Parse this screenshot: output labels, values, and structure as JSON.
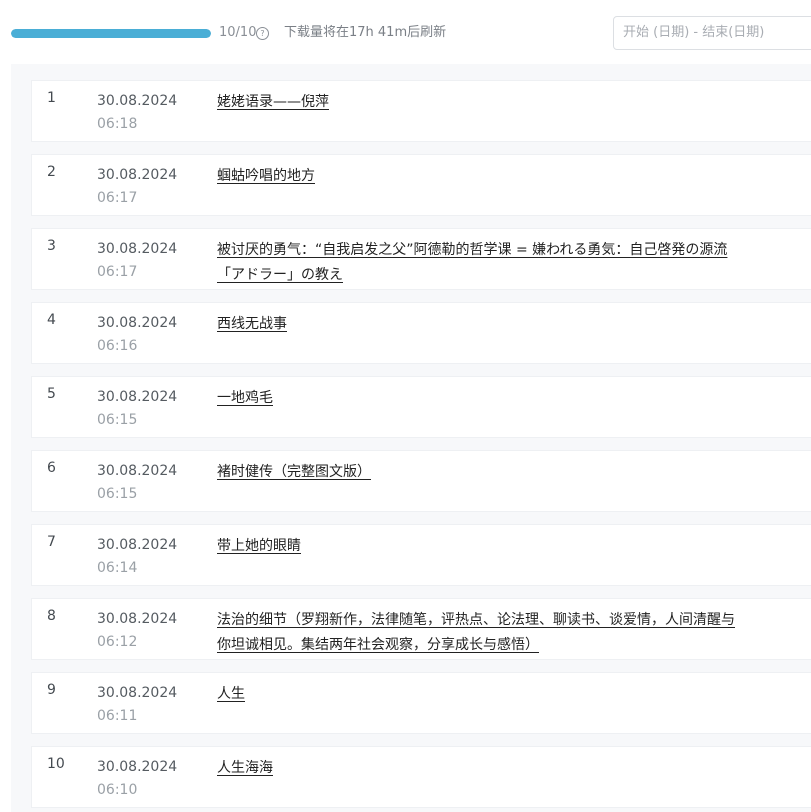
{
  "header": {
    "quota_progress": 1.0,
    "quota_text": "10/10",
    "refresh_text": "下载量将在17h 41m后刷新",
    "help_icon": "help-circle-icon",
    "date_range_placeholder": "开始 (日期) - 结束(日期)",
    "colors": {
      "progress": "#4aaed6",
      "track": "#e8eef2"
    }
  },
  "downloads": [
    {
      "index": "1",
      "date": "30.08.2024",
      "time": "06:18",
      "title": "姥姥语录——倪萍"
    },
    {
      "index": "2",
      "date": "30.08.2024",
      "time": "06:17",
      "title": "蝈蛄吟唱的地方"
    },
    {
      "index": "3",
      "date": "30.08.2024",
      "time": "06:17",
      "title": "被讨厌的勇气：“自我启发之父”阿德勒的哲学课 = 嫌われる勇気：自己啓発の源流「アドラー」の教え"
    },
    {
      "index": "4",
      "date": "30.08.2024",
      "time": "06:16",
      "title": "西线无战事"
    },
    {
      "index": "5",
      "date": "30.08.2024",
      "time": "06:15",
      "title": "一地鸡毛"
    },
    {
      "index": "6",
      "date": "30.08.2024",
      "time": "06:15",
      "title": "褚时健传（完整图文版）"
    },
    {
      "index": "7",
      "date": "30.08.2024",
      "time": "06:14",
      "title": "带上她的眼睛"
    },
    {
      "index": "8",
      "date": "30.08.2024",
      "time": "06:12",
      "title": "法治的细节（罗翔新作，法律随笔，评热点、论法理、聊读书、谈爱情，人间清醒与你坦诚相见。集结两年社会观察，分享成长与感悟）"
    },
    {
      "index": "9",
      "date": "30.08.2024",
      "time": "06:11",
      "title": "人生"
    },
    {
      "index": "10",
      "date": "30.08.2024",
      "time": "06:10",
      "title": "人生海海"
    }
  ]
}
